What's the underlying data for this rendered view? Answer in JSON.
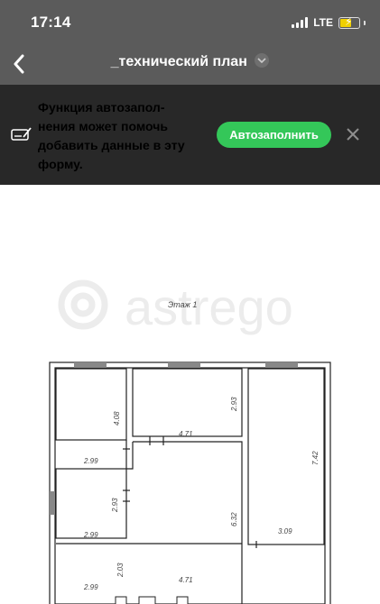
{
  "status_bar": {
    "time": "17:14",
    "network": "LTE"
  },
  "nav": {
    "title": "_технический план",
    "back_icon": "chevron-left-icon",
    "dropdown_icon": "chevron-down-icon"
  },
  "banner": {
    "text": "Функция автозапол- нения может помочь добавить данные в эту форму.",
    "lines": [
      "Функция автозапол-",
      "нения может помочь",
      "добавить данные в эту",
      "форму."
    ],
    "button_label": "Автозаполнить",
    "icon": "autofill-pen-icon",
    "close_icon": "close-icon",
    "accent": "#34c759"
  },
  "plan": {
    "watermark": "astrego",
    "floor_label": "Этаж 1",
    "dimensions": [
      "4.08",
      "2.93",
      "4.71",
      "7.42",
      "2.99",
      "2.93",
      "6.32",
      "2.99",
      "3.09",
      "2.03",
      "4.71",
      "2.99"
    ]
  }
}
